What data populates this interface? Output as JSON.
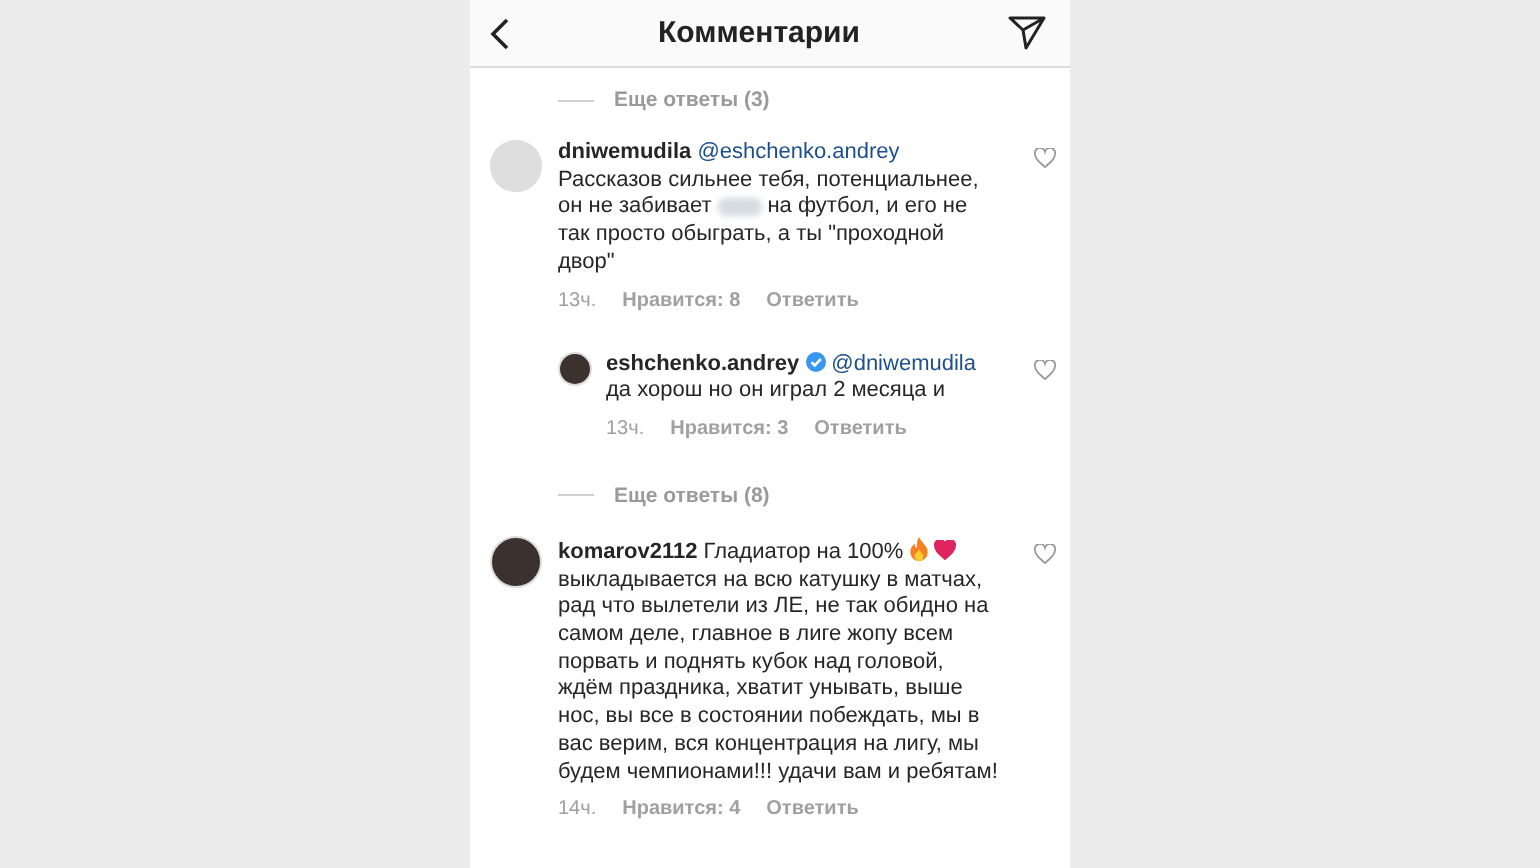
{
  "header": {
    "title": "Комментарии"
  },
  "items": [
    {
      "kind": "more",
      "label": "Еще ответы (3)"
    },
    {
      "kind": "comment",
      "reply": false,
      "avatar_photo": false,
      "username": "dniwemudila",
      "verified": false,
      "mention": "@eshchenko.andrey",
      "text": "Рассказов сильнее тебя, потенциальнее, он не забивает",
      "redacted": true,
      "text_after": "на футбол, и его не так просто обыграть, а ты \"проходной двор\"",
      "time": "13ч.",
      "likes": "Нравится: 8",
      "reply_label": "Ответить"
    },
    {
      "kind": "comment",
      "reply": true,
      "avatar_photo": true,
      "username": "eshchenko.andrey",
      "verified": true,
      "mention": "@dniwemudila",
      "text": "да хорош но он играл 2 месяца и",
      "redacted": false,
      "time": "13ч.",
      "likes": "Нравится: 3",
      "reply_label": "Ответить"
    },
    {
      "kind": "more",
      "label": "Еще ответы (8)"
    },
    {
      "kind": "comment",
      "reply": false,
      "avatar_photo": true,
      "username": "komarov2112",
      "verified": false,
      "text": "Гладиатор на 100%",
      "reactions": [
        {
          "kind": "fire"
        },
        {
          "kind": "heart"
        }
      ],
      "text_after": "выкладывается на всю катушку в матчах, рад что вылетели из ЛЕ, не так обидно на самом деле, главное в лиге жопу всем порвать и поднять кубок над головой, ждём праздника, хватит унывать, выше нос, вы все в состоянии побеждать, мы в вас верим, вся концентрация на лигу, мы будем чемпионами!!! удачи вам и ребятам!",
      "redacted": false,
      "time": "14ч.",
      "likes": "Нравится: 4",
      "reply_label": "Ответить"
    }
  ]
}
